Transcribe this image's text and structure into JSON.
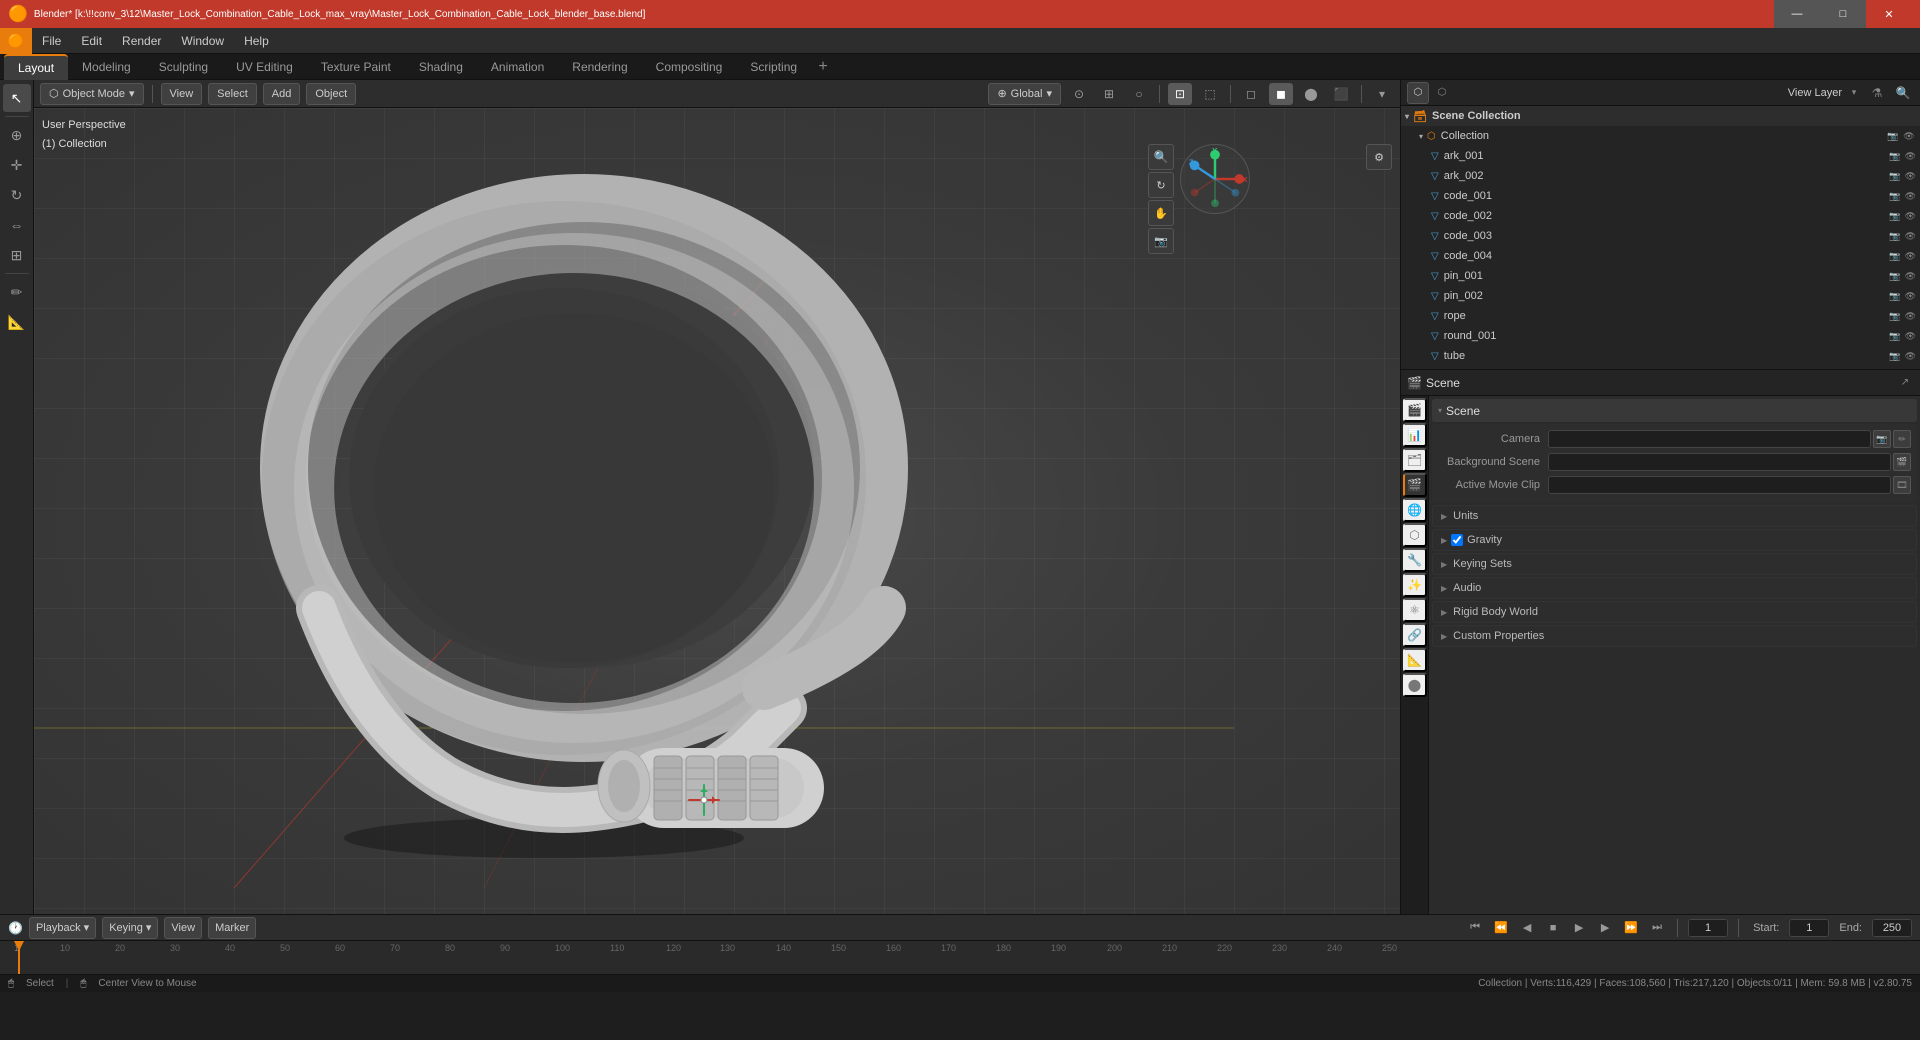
{
  "window": {
    "title": "Blender* [k:\\!!conv_3\\12\\Master_Lock_Combination_Cable_Lock_max_vray\\Master_Lock_Combination_Cable_Lock_blender_base.blend]",
    "minimize": "—",
    "maximize": "□",
    "close": "✕"
  },
  "menubar": {
    "logo": "🟠",
    "items": [
      "File",
      "Edit",
      "Render",
      "Window",
      "Help"
    ]
  },
  "workspace_tabs": {
    "tabs": [
      "Layout",
      "Modeling",
      "Sculpting",
      "UV Editing",
      "Texture Paint",
      "Shading",
      "Animation",
      "Rendering",
      "Compositing",
      "Scripting"
    ],
    "active": "Layout",
    "add_btn": "+"
  },
  "viewport_header": {
    "mode": "Object Mode",
    "view_label": "View",
    "select_label": "Select",
    "add_label": "Add",
    "object_label": "Object",
    "transform_global": "Global",
    "transform_icon": "⊕",
    "cursor_icon": "⊙",
    "snap_label": "·",
    "proportional": "○"
  },
  "viewport_info": {
    "line1": "User Perspective",
    "line2": "(1) Collection"
  },
  "viewport_overlays": {
    "items": [
      "⊞",
      "⊡",
      "👁",
      "⊕"
    ]
  },
  "timeline": {
    "fps_label": "Playback",
    "keying_label": "Keying",
    "view_label": "View",
    "marker_label": "Marker",
    "start": "1",
    "end": "250",
    "current": "1",
    "start_label": "Start:",
    "end_label": "End:",
    "play_icon": "▶",
    "prev_icon": "◀",
    "next_icon": "▶",
    "skip_start_icon": "⏮",
    "skip_end_icon": "⏭",
    "stop_icon": "■",
    "frame_numbers": [
      "1",
      "10",
      "20",
      "30",
      "40",
      "50",
      "60",
      "70",
      "80",
      "90",
      "100",
      "110",
      "120",
      "130",
      "140",
      "150",
      "160",
      "170",
      "180",
      "190",
      "200",
      "210",
      "220",
      "230",
      "240",
      "250"
    ]
  },
  "statusbar": {
    "select": "Select",
    "center_view": "Center View to Mouse",
    "collection_info": "Collection | Verts:116,429 | Faces:108,560 | Tris:217,120 | Objects:0/11 | Mem: 59.8 MB | v2.80.75"
  },
  "outliner": {
    "title": "Scene Collection",
    "items": [
      {
        "name": "Collection",
        "type": "collection",
        "indent": 0,
        "expanded": true,
        "visible": true
      },
      {
        "name": "ark_001",
        "type": "mesh",
        "indent": 1,
        "visible": true
      },
      {
        "name": "ark_002",
        "type": "mesh",
        "indent": 1,
        "visible": true
      },
      {
        "name": "code_001",
        "type": "mesh",
        "indent": 1,
        "visible": true
      },
      {
        "name": "code_002",
        "type": "mesh",
        "indent": 1,
        "visible": true
      },
      {
        "name": "code_003",
        "type": "mesh",
        "indent": 1,
        "visible": true
      },
      {
        "name": "code_004",
        "type": "mesh",
        "indent": 1,
        "visible": true
      },
      {
        "name": "pin_001",
        "type": "mesh",
        "indent": 1,
        "visible": true
      },
      {
        "name": "pin_002",
        "type": "mesh",
        "indent": 1,
        "visible": true
      },
      {
        "name": "rope",
        "type": "mesh",
        "indent": 1,
        "visible": true
      },
      {
        "name": "round_001",
        "type": "mesh",
        "indent": 1,
        "visible": true
      },
      {
        "name": "tube",
        "type": "mesh",
        "indent": 1,
        "visible": true
      }
    ]
  },
  "view_layer": {
    "label": "View Layer"
  },
  "properties": {
    "active_tab": "scene",
    "tabs": [
      "render",
      "output",
      "view_layer",
      "scene",
      "world",
      "object",
      "modifier",
      "particles",
      "physics",
      "constraints",
      "data",
      "material"
    ],
    "scene_label": "Scene",
    "sections": {
      "scene": {
        "title": "Scene",
        "camera_label": "Camera",
        "camera_value": "",
        "bg_scene_label": "Background Scene",
        "bg_scene_value": "",
        "movie_clip_label": "Active Movie Clip",
        "movie_clip_value": ""
      },
      "units": {
        "title": "Units",
        "collapsed": true
      },
      "gravity": {
        "title": "Gravity",
        "enabled": true,
        "collapsed": false
      },
      "keying_sets": {
        "title": "Keying Sets",
        "collapsed": true
      },
      "audio": {
        "title": "Audio",
        "collapsed": true
      },
      "rigid_body_world": {
        "title": "Rigid Body World",
        "collapsed": true
      },
      "custom_properties": {
        "title": "Custom Properties",
        "collapsed": true
      }
    }
  },
  "gizmo": {
    "x_label": "X",
    "y_label": "Y",
    "z_label": "Z",
    "x_neg": "-X",
    "y_neg": "-Y",
    "z_neg": "-Z"
  },
  "colors": {
    "accent": "#e87d0d",
    "header_bg": "#2d2d2d",
    "panel_bg": "#2b2b2b",
    "viewport_bg": "#3d3d3d",
    "active_tab": "#3d3d3d",
    "selected_item": "#1a4a8a",
    "section_bg": "#333",
    "red_axis": "#c0392b",
    "green_axis": "#27ae60",
    "yellow_axis": "#f1c40f"
  }
}
